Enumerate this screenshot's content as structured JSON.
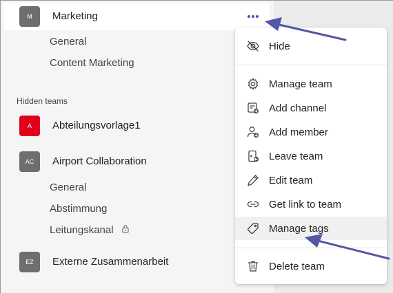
{
  "teams": {
    "marketing": {
      "initials": "M",
      "name": "Marketing"
    },
    "marketing_channels": [
      "General",
      "Content Marketing"
    ],
    "hidden_label": "Hidden teams",
    "abteilung": {
      "initials": "A",
      "name": "Abteilungsvorlage1",
      "color": "#e0001b"
    },
    "airport": {
      "initials": "AC",
      "name": "Airport Collaboration"
    },
    "airport_channels": [
      "General",
      "Abstimmung",
      "Leitungskanal"
    ],
    "externe": {
      "initials": "EZ",
      "name": "Externe Zusammenarbeit"
    }
  },
  "menu": {
    "hide": "Hide",
    "manage_team": "Manage team",
    "add_channel": "Add channel",
    "add_member": "Add member",
    "leave_team": "Leave team",
    "edit_team": "Edit team",
    "get_link": "Get link to team",
    "manage_tags": "Manage tags",
    "delete_team": "Delete team"
  },
  "colors": {
    "accent": "#4f52b2",
    "annotation_arrow": "#5457a6"
  }
}
